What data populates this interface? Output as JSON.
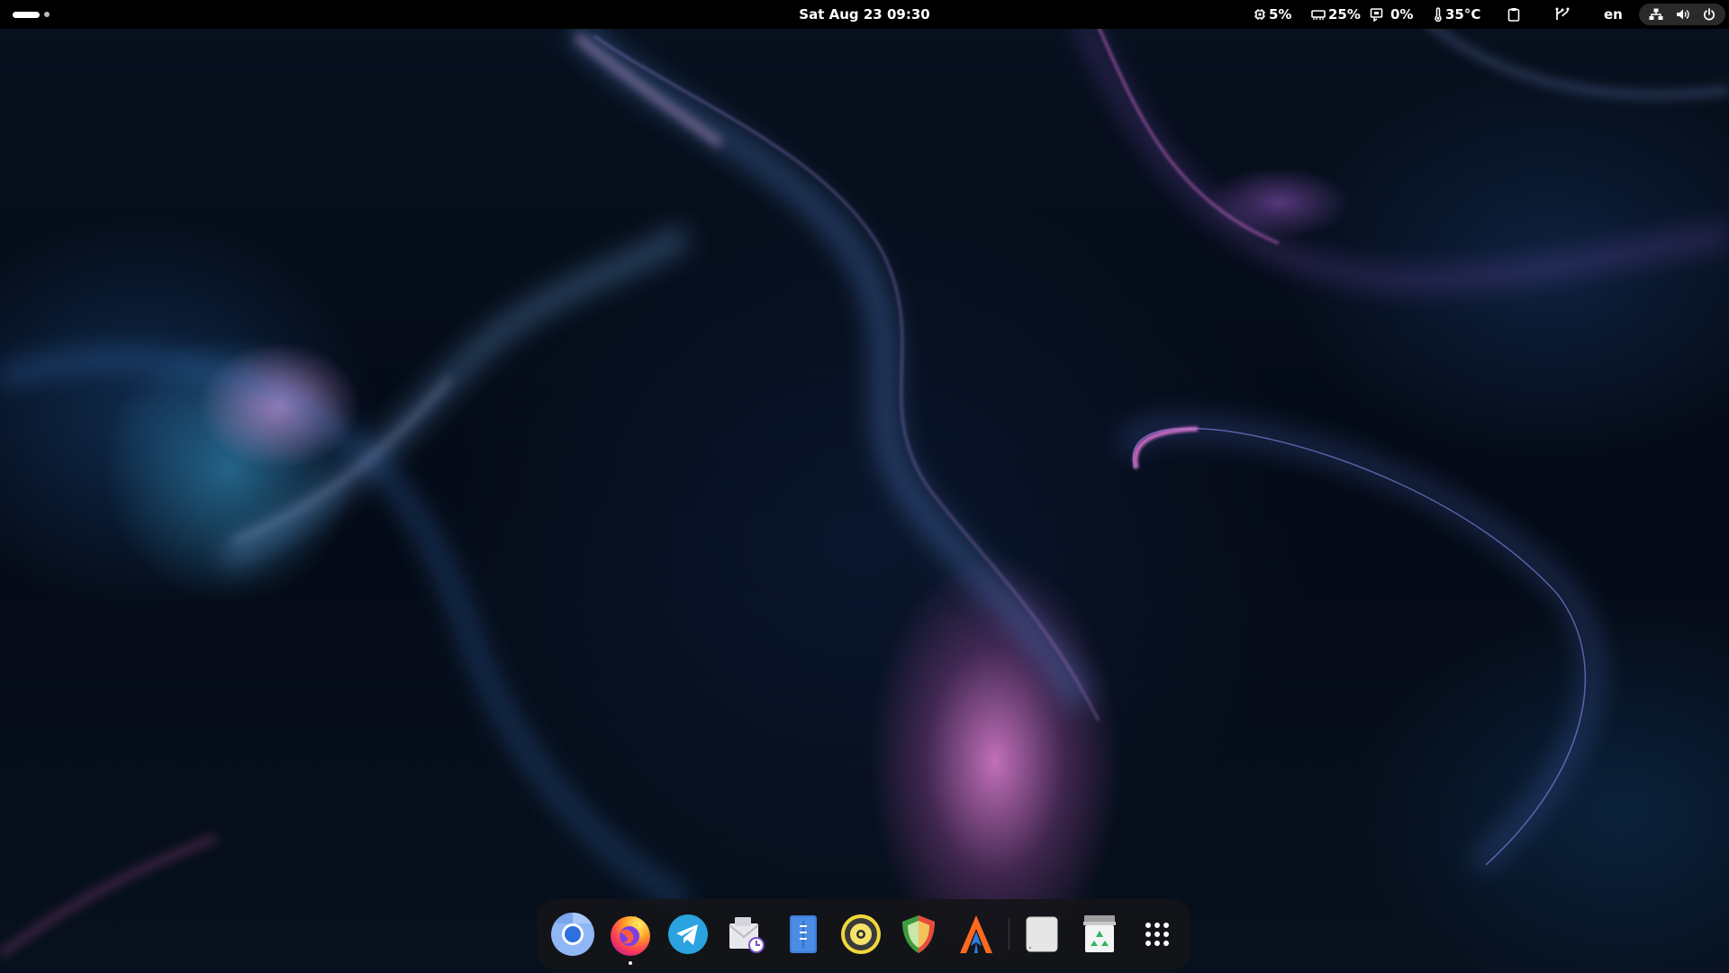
{
  "topbar": {
    "activities_icon": "activities-indicator-icon",
    "clock": "Sat Aug 23  09:30",
    "cpu": {
      "icon": "cpu-icon",
      "value": "5%"
    },
    "memory": {
      "icon": "memory-icon",
      "value": "25%"
    },
    "swap": {
      "icon": "swap-icon",
      "value": "0%"
    },
    "temperature": {
      "icon": "thermometer-icon",
      "value": "35°C"
    },
    "clipboard_icon": "clipboard-icon",
    "vcs_icon": "branch-icon",
    "keyboard_layout": "en",
    "system_menu": {
      "network_icon": "network-wired-icon",
      "volume_icon": "speaker-volume-icon",
      "power_icon": "power-icon"
    }
  },
  "dock": {
    "items": [
      {
        "name": "Chromium",
        "icon": "chromium-icon",
        "running": false
      },
      {
        "name": "Firefox",
        "icon": "firefox-icon",
        "running": true
      },
      {
        "name": "Telegram",
        "icon": "telegram-icon",
        "running": false
      },
      {
        "name": "Mail Scheduler",
        "icon": "mail-clock-icon",
        "running": false
      },
      {
        "name": "Text Editor",
        "icon": "text-editor-icon",
        "running": false
      },
      {
        "name": "Music Player",
        "icon": "music-player-icon",
        "running": false
      },
      {
        "name": "Shield",
        "icon": "shield-icon",
        "running": false
      },
      {
        "name": "Arch Launcher",
        "icon": "arch-a-icon",
        "running": false
      },
      {
        "name": "Drive",
        "icon": "drive-icon",
        "running": false
      },
      {
        "name": "Trash",
        "icon": "trash-icon",
        "running": false
      },
      {
        "name": "Show Apps",
        "icon": "app-grid-icon",
        "running": false
      }
    ]
  },
  "colors": {
    "accent_pink": "#e080d4",
    "accent_blue": "#3c9ee0",
    "topbar": "#000000",
    "dock": "#141418"
  }
}
